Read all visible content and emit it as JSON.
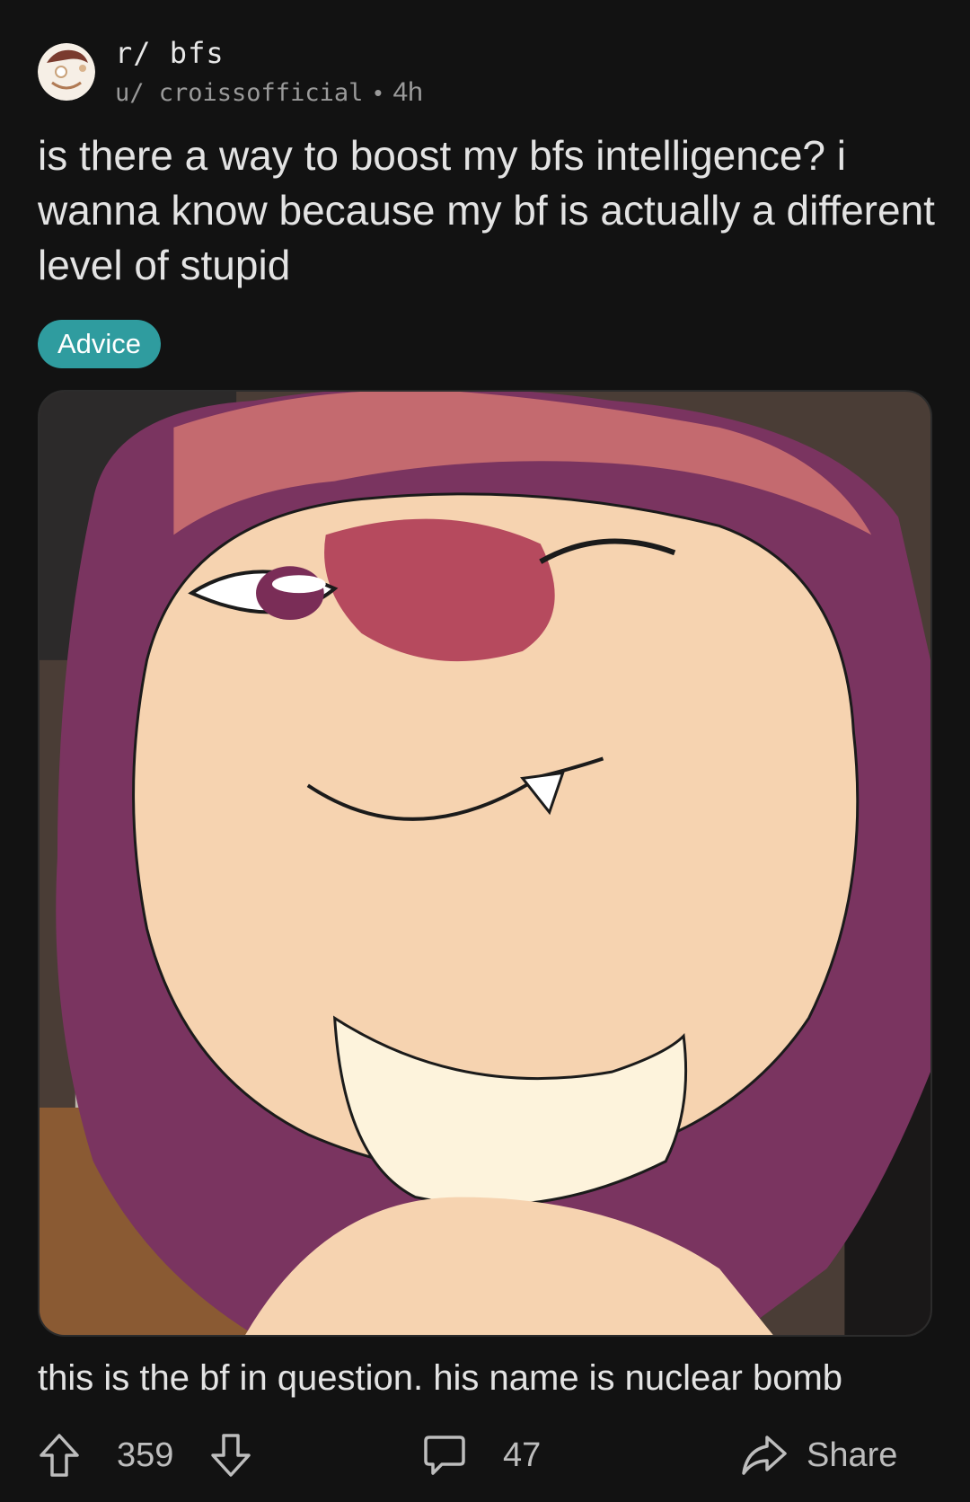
{
  "post": {
    "subreddit": "r/ bfs",
    "username": "u/ croissofficial",
    "separator": "•",
    "time": "4h",
    "title": "is there a way to boost my bfs intelligence? i wanna know because my bf is actually a different level of stupid",
    "flair": "Advice",
    "flair_color": "#2f9c9f",
    "caption": "this is the bf in question. his name is nuclear bomb"
  },
  "actions": {
    "upvote_icon": "arrow-up-icon",
    "vote_count": "359",
    "downvote_icon": "arrow-down-icon",
    "comment_icon": "comment-icon",
    "comment_count": "47",
    "share_icon": "share-arrow-icon",
    "share_label": "Share"
  }
}
